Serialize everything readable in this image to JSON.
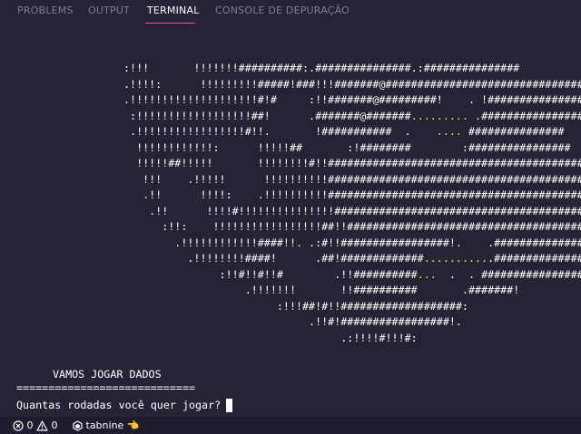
{
  "panel": {
    "tabs": [
      {
        "label": "PROBLEMS",
        "active": false
      },
      {
        "label": "OUTPUT",
        "active": false
      },
      {
        "label": "TERMINAL",
        "active": true
      },
      {
        "label": "CONSOLE DE DEPURAÇÃO",
        "active": false
      }
    ]
  },
  "terminal": {
    "art_lines": [
      [
        ":!!!       !!!!!!!##########:.###############.:###############"
      ],
      [
        ".!!!!:      !!!!!!!!!#####!###!!!#######@#################################"
      ],
      [
        ".!!!!!!!!!!!!!!!!!!!!#!#     :!!#######@#########!    . !#################"
      ],
      [
        " :!!!!!!!!!!!!!!!!!!##!      .#######@#######",
        ".........",
        " .################"
      ],
      [
        " .!!!!!!!!!!!!!!!!!#!!.       !###########  .    ",
        "....",
        " ###############"
      ],
      [
        "  !!!!!!!!!!!!:      !!!!!##       :!########        :################"
      ],
      [
        "  !!!!!##!!!!!       !!!!!!!!#!!#################################################"
      ],
      [
        "   !!!    .!!!!!      !!!!!!!!!!##########################################"
      ],
      [
        "   .!!      !!!!:    .!!!!!!!!!!##########################################"
      ],
      [
        "    .!!      !!!!#!!!!!!!!!!!!!!!###########################################"
      ],
      [
        "      :!!:    !!!!!!!!!!!!!!!!!##!!######################################"
      ],
      [
        "        .!!!!!!!!!!!!####!!. .:#!!#################!.    .###############"
      ],
      [
        "          .!!!!!!!!####!      .##!#############",
        "..........",
        ".#################"
      ],
      [
        "               :!!#!!#!!#        .!!##########",
        "...",
        "  .  . ##################"
      ],
      [
        "                   .!!!!!!!       !!##########       .#######!"
      ],
      [
        "                        :!!!##!#!!###################:"
      ],
      [
        "                             .!!#!#################!."
      ],
      [
        "                                  .:!!!!#!!!#:"
      ]
    ],
    "title": "VAMOS JOGAR DADOS",
    "separator": "============================",
    "prompt": "Quantas rodadas você quer jogar?"
  },
  "statusbar": {
    "errors": "0",
    "warnings": "0",
    "tabnine_label": "tabnine",
    "tabnine_glyph": "👈"
  },
  "colors": {
    "background": "#262335",
    "statusbar_bg": "#1f1d2d",
    "tab_inactive": "#7c7a96",
    "tab_active_underline": "#e95a9c",
    "highlight_dots": "#fede5d"
  }
}
